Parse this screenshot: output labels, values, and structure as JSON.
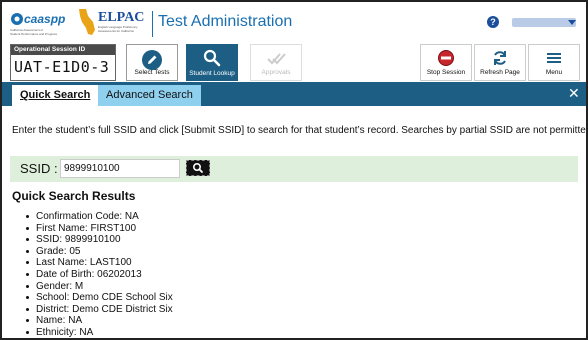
{
  "header": {
    "logo_caaspp": "caaspp",
    "logo_caaspp_sub": "California Assessment of Student Performance and Progress",
    "logo_elpac": "ELPAC",
    "logo_elpac_sub": "English Language Proficiency Assessments for California",
    "title": "Test Administration",
    "help_icon": "?",
    "help_icon_name": "help-icon",
    "user_menu_icon": "chevron-down-icon"
  },
  "session": {
    "label": "Operational Session ID",
    "id": "UAT-E1D0-3"
  },
  "toolbar": {
    "select_tests": "Select Tests",
    "student_lookup": "Student Lookup",
    "approvals": "Approvals",
    "stop_session": "Stop Session",
    "refresh_page": "Refresh Page",
    "menu": "Menu"
  },
  "tabs": {
    "quick": "Quick Search",
    "advanced": "Advanced Search",
    "close": "✕"
  },
  "instructions": "Enter the student’s full SSID and click [Submit SSID] to search for that student’s record. Searches by partial SSID are not permitted.",
  "ssid": {
    "label": "SSID :",
    "value": "9899910100"
  },
  "results": {
    "title": "Quick Search Results",
    "items": [
      "Confirmation Code: NA",
      "First Name: FIRST100",
      "SSID: 9899910100",
      "Grade: 05",
      "Last Name: LAST100",
      "Date of Birth: 06202013",
      "Gender: M",
      "School: Demo CDE School Six",
      "District: Demo CDE District Six",
      "Name: NA",
      "Ethnicity: NA"
    ]
  },
  "colors": {
    "brand_blue": "#1a6fb0",
    "panel_bar": "#1d5f84",
    "active_tab": "#8fd0ef",
    "ssid_bar": "#def0db"
  }
}
